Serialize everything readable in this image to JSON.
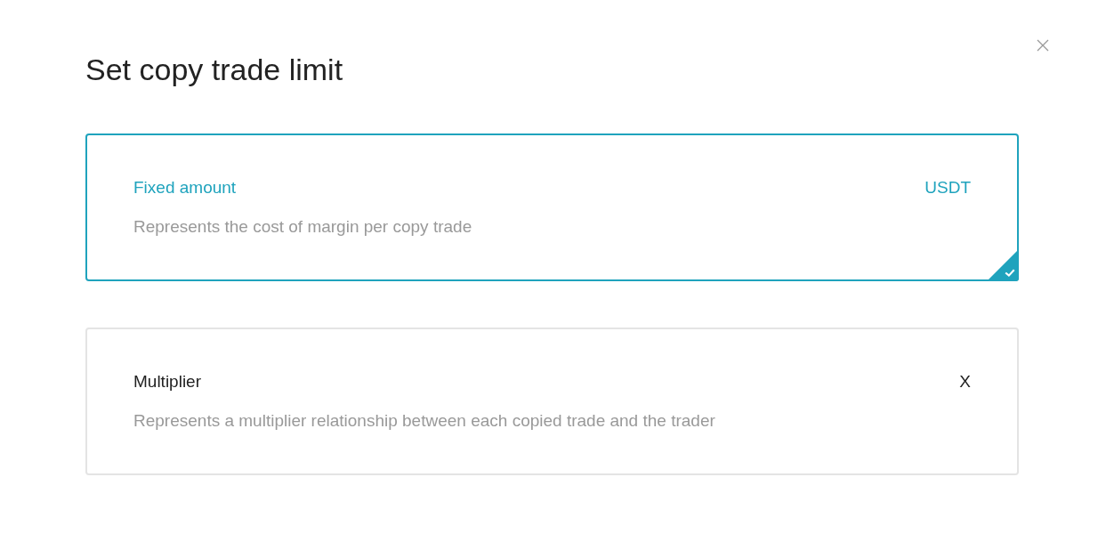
{
  "dialog": {
    "title": "Set copy trade limit"
  },
  "options": [
    {
      "label": "Fixed amount",
      "unit": "USDT",
      "description": "Represents the cost of margin per copy trade",
      "selected": true
    },
    {
      "label": "Multiplier",
      "unit": "X",
      "description": "Represents a multiplier relationship between each copied trade and the trader",
      "selected": false
    }
  ]
}
